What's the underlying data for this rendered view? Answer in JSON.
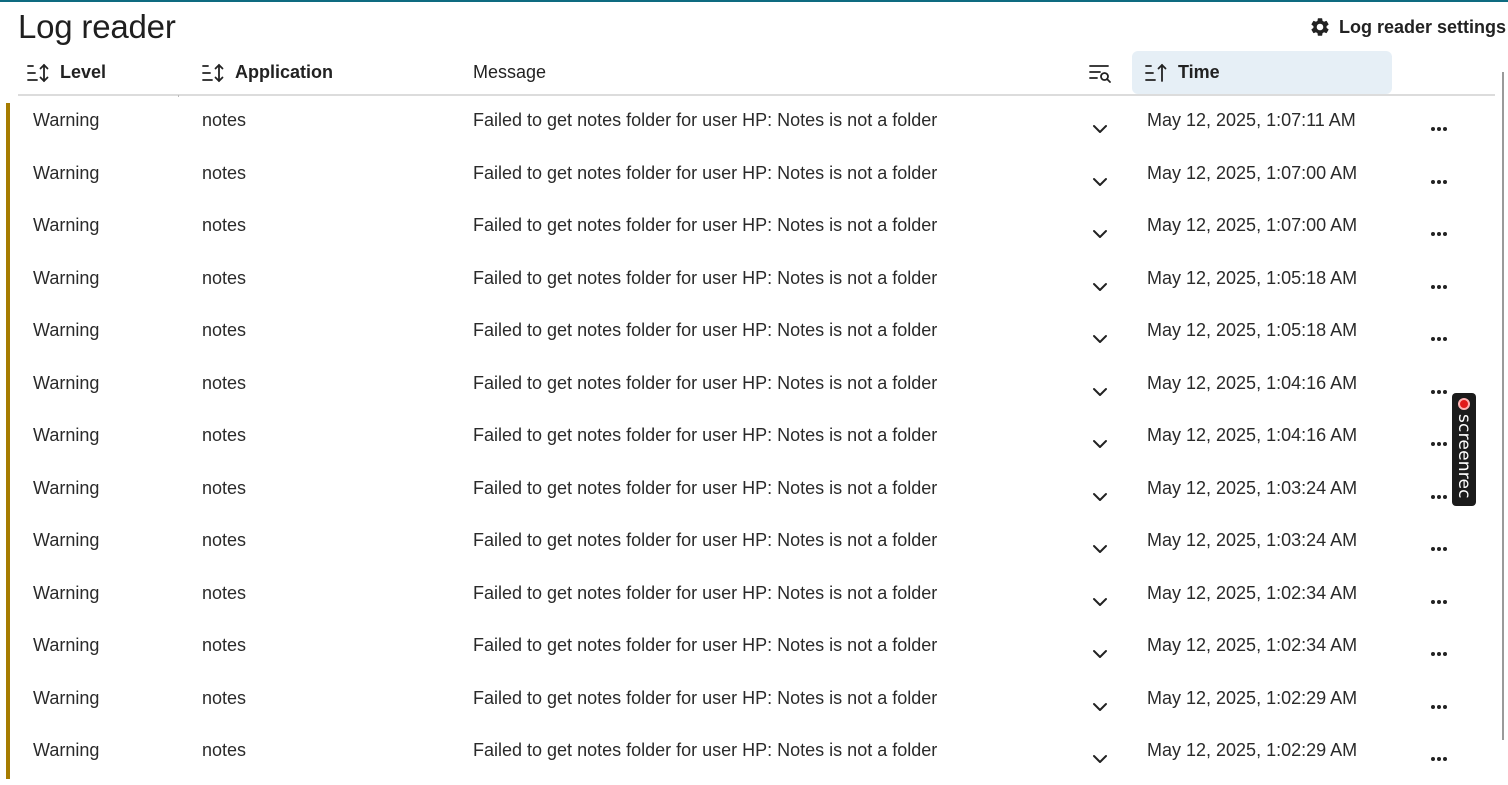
{
  "page": {
    "title": "Log reader",
    "settings_label": "Log reader settings"
  },
  "columns": {
    "level": "Level",
    "application": "Application",
    "message": "Message",
    "time": "Time"
  },
  "icons": {
    "settings": "gear-icon",
    "sort": "sort-icon",
    "sort_ascending": "sort-ascending-icon",
    "filter": "filter-search-icon",
    "expand": "chevron-down-icon",
    "more": "more-horizontal-icon"
  },
  "colors": {
    "accent_top": "#0e6b80",
    "warning_bar": "#a67c00",
    "time_header_bg": "#e6eff6"
  },
  "rows": [
    {
      "level": "Warning",
      "app": "notes",
      "message": "Failed to get notes folder for user HP: Notes is not a folder",
      "time": "May 12, 2025, 1:07:11 AM"
    },
    {
      "level": "Warning",
      "app": "notes",
      "message": "Failed to get notes folder for user HP: Notes is not a folder",
      "time": "May 12, 2025, 1:07:00 AM"
    },
    {
      "level": "Warning",
      "app": "notes",
      "message": "Failed to get notes folder for user HP: Notes is not a folder",
      "time": "May 12, 2025, 1:07:00 AM"
    },
    {
      "level": "Warning",
      "app": "notes",
      "message": "Failed to get notes folder for user HP: Notes is not a folder",
      "time": "May 12, 2025, 1:05:18 AM"
    },
    {
      "level": "Warning",
      "app": "notes",
      "message": "Failed to get notes folder for user HP: Notes is not a folder",
      "time": "May 12, 2025, 1:05:18 AM"
    },
    {
      "level": "Warning",
      "app": "notes",
      "message": "Failed to get notes folder for user HP: Notes is not a folder",
      "time": "May 12, 2025, 1:04:16 AM"
    },
    {
      "level": "Warning",
      "app": "notes",
      "message": "Failed to get notes folder for user HP: Notes is not a folder",
      "time": "May 12, 2025, 1:04:16 AM"
    },
    {
      "level": "Warning",
      "app": "notes",
      "message": "Failed to get notes folder for user HP: Notes is not a folder",
      "time": "May 12, 2025, 1:03:24 AM"
    },
    {
      "level": "Warning",
      "app": "notes",
      "message": "Failed to get notes folder for user HP: Notes is not a folder",
      "time": "May 12, 2025, 1:03:24 AM"
    },
    {
      "level": "Warning",
      "app": "notes",
      "message": "Failed to get notes folder for user HP: Notes is not a folder",
      "time": "May 12, 2025, 1:02:34 AM"
    },
    {
      "level": "Warning",
      "app": "notes",
      "message": "Failed to get notes folder for user HP: Notes is not a folder",
      "time": "May 12, 2025, 1:02:34 AM"
    },
    {
      "level": "Warning",
      "app": "notes",
      "message": "Failed to get notes folder for user HP: Notes is not a folder",
      "time": "May 12, 2025, 1:02:29 AM"
    },
    {
      "level": "Warning",
      "app": "notes",
      "message": "Failed to get notes folder for user HP: Notes is not a folder",
      "time": "May 12, 2025, 1:02:29 AM"
    }
  ],
  "watermark": {
    "text": "screenrec"
  }
}
